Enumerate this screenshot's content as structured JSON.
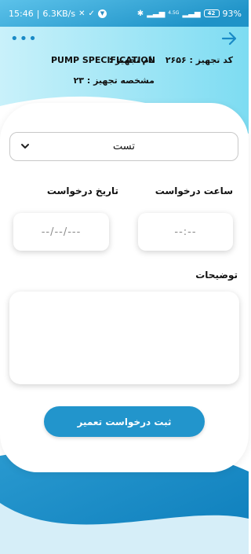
{
  "status_bar": {
    "time": "15:46",
    "network_speed": "6.3KB/s",
    "network_type": "4.5G",
    "sim_badge": "LTE",
    "battery_level": "42",
    "battery_percent": "93%"
  },
  "equipment": {
    "code_label": "کد تجهیز :",
    "code_value": "۲۶۵۶",
    "name_label": "نام تجهیز :",
    "name_value": "PUMP SPECIFICATION",
    "spec_label": "مشخصه تجهیز :",
    "spec_value": "۲۳"
  },
  "form": {
    "select_value": "تست",
    "time_label": "ساعت درخواست",
    "time_placeholder": "--:--",
    "date_label": "تاریخ درخواست",
    "date_placeholder": "--/--/---",
    "description_label": "توضیحات",
    "submit_label": "ثبت درخواست تعمیر"
  },
  "colors": {
    "accent": "#2295cc",
    "background_top": "#9fe6f6",
    "background_bottom": "#1b8fc7"
  }
}
